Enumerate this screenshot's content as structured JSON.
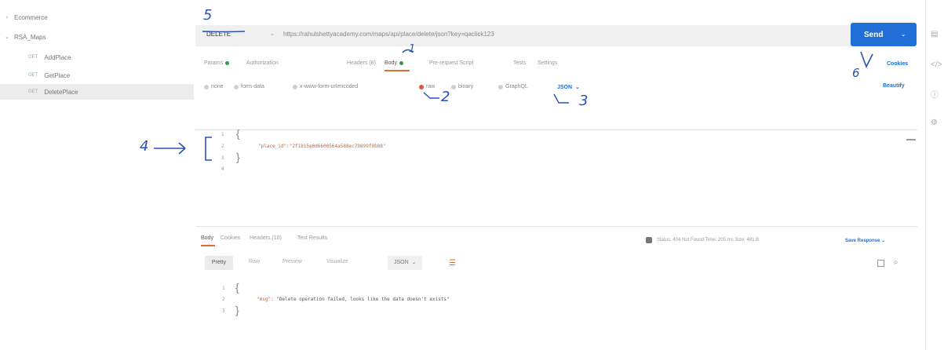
{
  "sidebar": {
    "items": [
      {
        "label": "Ecommerce",
        "chevron": "›"
      },
      {
        "label": "RSA_Maps",
        "chevron": "⌄"
      },
      {
        "method": "GET",
        "label": "AddPlace"
      },
      {
        "method": "GET",
        "label": "GetPlace"
      },
      {
        "method": "GET",
        "label": "DeletePlace"
      }
    ]
  },
  "request": {
    "method": "DELETE",
    "url": "https://rahulshettyacademy.com/maps/api/place/delete/json?key=qaclick123",
    "send_label": "Send"
  },
  "tabs": {
    "params": "Params",
    "authorization": "Authorization",
    "headers": "Headers (8)",
    "body": "Body",
    "prerequest": "Pre-request Script",
    "tests": "Tests",
    "settings": "Settings",
    "cookies": "Cookies",
    "beautify": "Beautify"
  },
  "body_types": [
    "none",
    "form-data",
    "x-www-form-urlencoded",
    "raw",
    "binary",
    "GraphQL"
  ],
  "body_format": "JSON",
  "editor": {
    "line_numbers": [
      "1",
      "2",
      "3",
      "4"
    ],
    "brace_open": "{",
    "brace_close": "}",
    "line2": "\"place_id\":\"2f1815e0d6600564a588ec79899f0b88\""
  },
  "response": {
    "tabs": [
      "Body",
      "Cookies",
      "Headers (10)",
      "Test Results"
    ],
    "status": "Status: 404 Not Found  Time: 205 ms  Size: 481 B",
    "save": "Save Response",
    "formats": [
      "Pretty",
      "Raw",
      "Preview",
      "Visualize"
    ],
    "format_selected": "JSON",
    "line_numbers": [
      "1",
      "2",
      "3"
    ],
    "brace_open": "{",
    "brace_close": "}",
    "key": "\"msg\"",
    "value": ": \"Delete operation failed, looks like the data doesn't exists\""
  },
  "annotations": [
    "5",
    "1",
    "2",
    "3",
    "4",
    "6"
  ],
  "colors": {
    "send": "#1f6fd6",
    "active_tab": "#e06c3a",
    "ink": "#2852b8"
  }
}
